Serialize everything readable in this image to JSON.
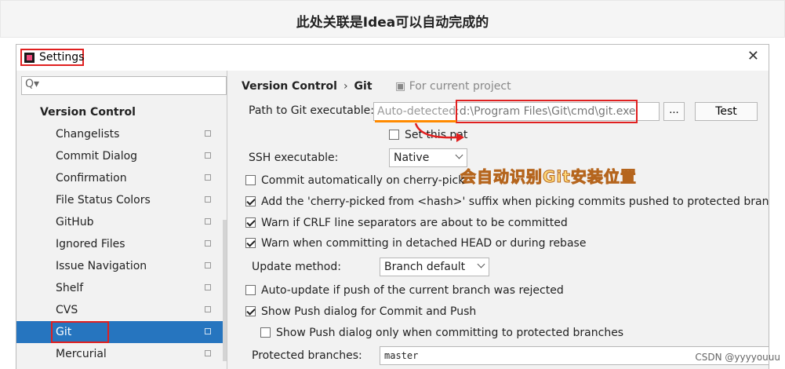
{
  "banner": {
    "title": "此处关联是Idea可以自动完成的"
  },
  "window": {
    "title": "Settings",
    "close_glyph": "✕"
  },
  "sidebar": {
    "search_glyph": "Q▾",
    "section": "Version Control",
    "items": [
      {
        "label": "Changelists"
      },
      {
        "label": "Commit Dialog"
      },
      {
        "label": "Confirmation"
      },
      {
        "label": "File Status Colors"
      },
      {
        "label": "GitHub"
      },
      {
        "label": "Ignored Files"
      },
      {
        "label": "Issue Navigation"
      },
      {
        "label": "Shelf"
      },
      {
        "label": "CVS"
      },
      {
        "label": "Git"
      },
      {
        "label": "Mercurial"
      }
    ],
    "selected": "Git"
  },
  "main": {
    "breadcrumb": {
      "parent": "Version Control",
      "separator": "›",
      "current": "Git"
    },
    "scope_note": "For current project",
    "path_label": "Path to Git executable:",
    "path_placeholder": "Auto-detected:",
    "path_value": "d:\\Program Files\\Git\\cmd\\git.exe",
    "browse_label": "...",
    "test_label": "Test",
    "set_path_label": "Set this pat",
    "annotation": "会自动识别Git安装位置",
    "ssh_label": "SSH executable:",
    "ssh_value": "Native",
    "checkboxes": [
      {
        "label": "Commit automatically on cherry-pick",
        "checked": false
      },
      {
        "label": "Add the 'cherry-picked from <hash>' suffix when picking commits pushed to protected branches",
        "checked": true
      },
      {
        "label": "Warn if CRLF line separators are about to be committed",
        "checked": true
      },
      {
        "label": "Warn when committing in detached HEAD or during rebase",
        "checked": true
      }
    ],
    "update_method_label": "Update method:",
    "update_method_value": "Branch default",
    "checkboxes2": [
      {
        "label": "Auto-update if push of the current branch was rejected",
        "checked": false
      },
      {
        "label": "Show Push dialog for Commit and Push",
        "checked": true
      },
      {
        "label": "Show Push dialog only when committing to protected branches",
        "checked": false
      }
    ],
    "protected_label": "Protected branches:",
    "protected_value": "master"
  },
  "watermark": "CSDN @yyyyouuu",
  "colors": {
    "accent_selection": "#2675bf",
    "highlight_box": "#e02020",
    "underline": "#ff8a00"
  }
}
